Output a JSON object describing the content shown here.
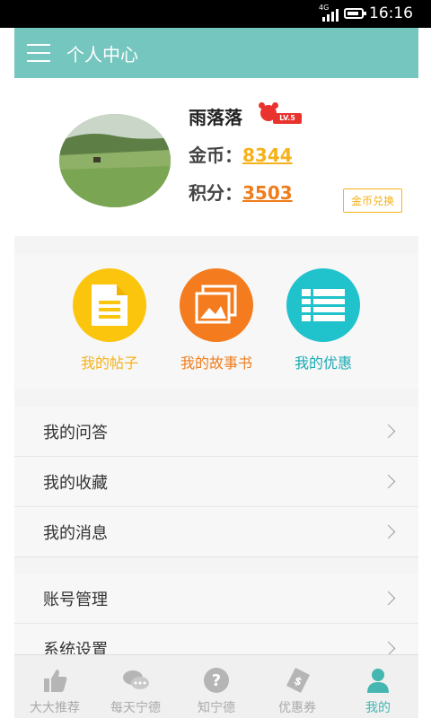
{
  "status": {
    "network": "4G",
    "time": "16:16"
  },
  "header": {
    "title": "个人中心"
  },
  "profile": {
    "username": "雨落落",
    "level": "LV.5",
    "gold_label": "金币：",
    "gold_value": "8344",
    "points_label": "积分：",
    "points_value": "3503",
    "exchange_label": "金币兑换"
  },
  "quick_actions": [
    {
      "label": "我的帖子",
      "icon": "document-icon",
      "color": "#f5bf0f"
    },
    {
      "label": "我的故事书",
      "icon": "picture-frame-icon",
      "color": "#f07f1a"
    },
    {
      "label": "我的优惠",
      "icon": "list-icon",
      "color": "#1fc0c9"
    }
  ],
  "menu_group1": [
    {
      "label": "我的问答"
    },
    {
      "label": "我的收藏"
    },
    {
      "label": "我的消息"
    }
  ],
  "menu_group2": [
    {
      "label": "账号管理"
    },
    {
      "label": "系统设置"
    }
  ],
  "tabs": [
    {
      "label": "大大推荐",
      "icon": "thumbs-up-icon"
    },
    {
      "label": "每天宁德",
      "icon": "chat-icon"
    },
    {
      "label": "知宁德",
      "icon": "question-icon"
    },
    {
      "label": "优惠券",
      "icon": "coupon-icon"
    },
    {
      "label": "我的",
      "icon": "user-icon",
      "active": true
    }
  ],
  "colors": {
    "header": "#75c6bf",
    "active_tab": "#45b6b0",
    "gold": "#f5b21a",
    "points": "#ef7d1b"
  }
}
